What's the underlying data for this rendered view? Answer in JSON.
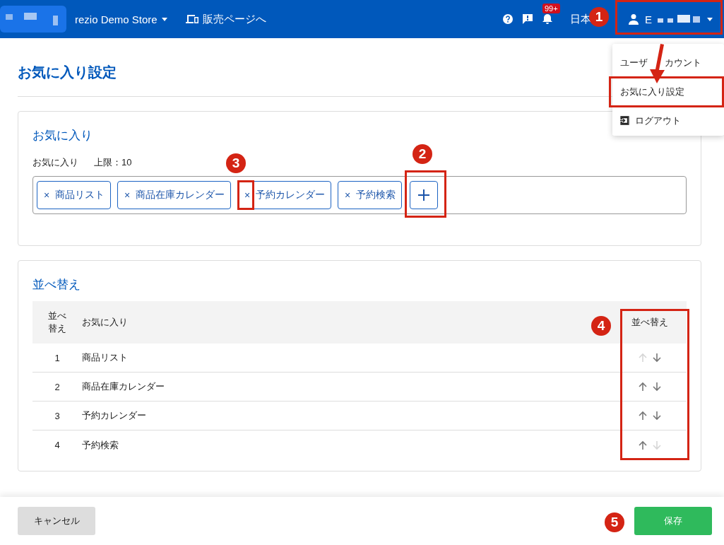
{
  "header": {
    "store_name": "rezio Demo Store",
    "sales_link": "販売ページへ",
    "notification_badge": "99+",
    "language": "日本",
    "user_initial": "E"
  },
  "user_menu": {
    "items": [
      {
        "kind": "split",
        "label": "ユーザ",
        "label_after": "カウント"
      },
      {
        "kind": "plain",
        "label": "お気に入り設定"
      },
      {
        "kind": "logout",
        "label": "ログアウト"
      }
    ]
  },
  "page_title": "お気に入り設定",
  "favorites": {
    "title": "お気に入り",
    "limit_label": "お気に入り",
    "limit_text": "上限：10",
    "chips": [
      {
        "remove": "×",
        "label": "商品リスト"
      },
      {
        "remove": "×",
        "label": "商品在庫カレンダー"
      },
      {
        "remove": "×",
        "label": "予約カレンダー"
      },
      {
        "remove": "×",
        "label": "予約検索"
      }
    ]
  },
  "sorting": {
    "title": "並べ替え",
    "columns": [
      "並べ替え",
      "お気に入り",
      "並べ替え"
    ],
    "rows": [
      {
        "number": "1",
        "name": "商品リスト",
        "up_disabled": true,
        "down_disabled": false
      },
      {
        "number": "2",
        "name": "商品在庫カレンダー",
        "up_disabled": false,
        "down_disabled": false
      },
      {
        "number": "3",
        "name": "予約カレンダー",
        "up_disabled": false,
        "down_disabled": false
      },
      {
        "number": "4",
        "name": "予約検索",
        "up_disabled": false,
        "down_disabled": true
      }
    ]
  },
  "footer": {
    "cancel": "キャンセル",
    "save": "保存"
  },
  "annotations": [
    "1",
    "2",
    "3",
    "4",
    "5"
  ]
}
